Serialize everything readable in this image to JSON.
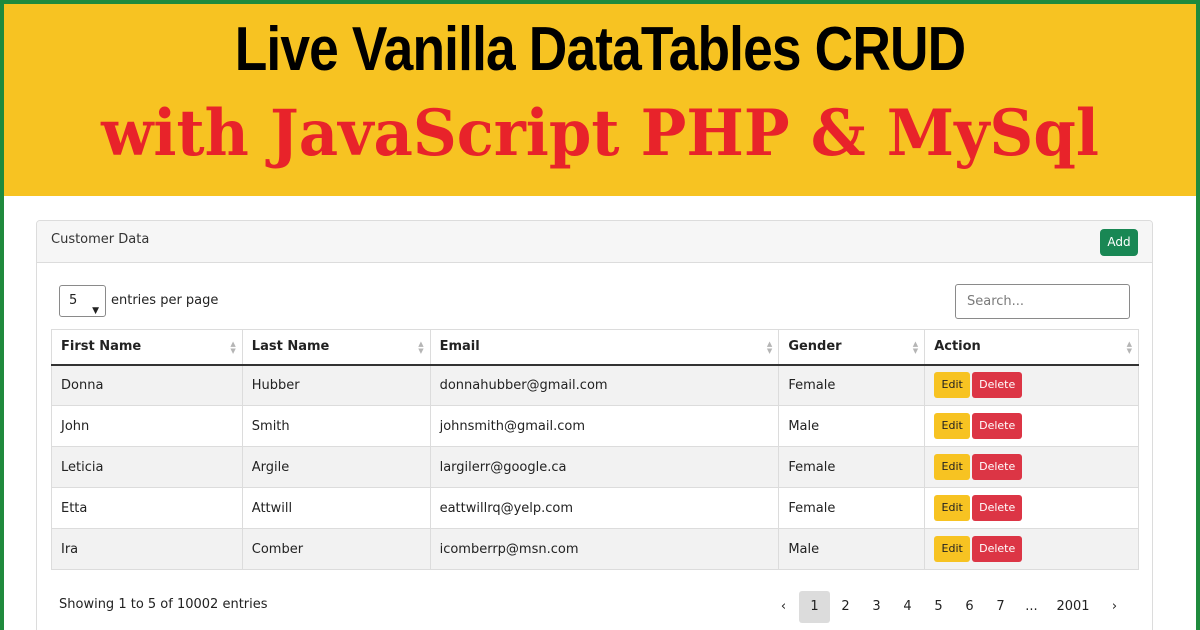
{
  "banner": {
    "line1": "Live Vanilla DataTables CRUD",
    "line2": "with JavaScript PHP & MySql"
  },
  "card": {
    "title": "Customer Data",
    "add_label": "Add"
  },
  "controls": {
    "per_page_value": "5",
    "per_page_label": "entries per page",
    "search_placeholder": "Search..."
  },
  "table": {
    "columns": [
      "First Name",
      "Last Name",
      "Email",
      "Gender",
      "Action"
    ],
    "rows": [
      {
        "first": "Donna",
        "last": "Hubber",
        "email": "donnahubber@gmail.com",
        "gender": "Female"
      },
      {
        "first": "John",
        "last": "Smith",
        "email": "johnsmith@gmail.com",
        "gender": "Male"
      },
      {
        "first": "Leticia",
        "last": "Argile",
        "email": "largilerr@google.ca",
        "gender": "Female"
      },
      {
        "first": "Etta",
        "last": "Attwill",
        "email": "eattwillrq@yelp.com",
        "gender": "Female"
      },
      {
        "first": "Ira",
        "last": "Comber",
        "email": "icomberrp@msn.com",
        "gender": "Male"
      }
    ],
    "edit_label": "Edit",
    "delete_label": "Delete"
  },
  "footer": {
    "info": "Showing 1 to 5 of 10002 entries",
    "pagination": {
      "prev": "‹",
      "pages": [
        "1",
        "2",
        "3",
        "4",
        "5",
        "6",
        "7"
      ],
      "ellipsis": "...",
      "last": "2001",
      "next": "›",
      "current": "1"
    }
  },
  "colors": {
    "banner_bg": "#f7c322",
    "banner_title": "#000000",
    "banner_subtitle": "#e8232a",
    "border_frame": "#1f8a3d",
    "add_button": "#198754",
    "edit_button": "#f7c322",
    "delete_button": "#dc3545"
  }
}
